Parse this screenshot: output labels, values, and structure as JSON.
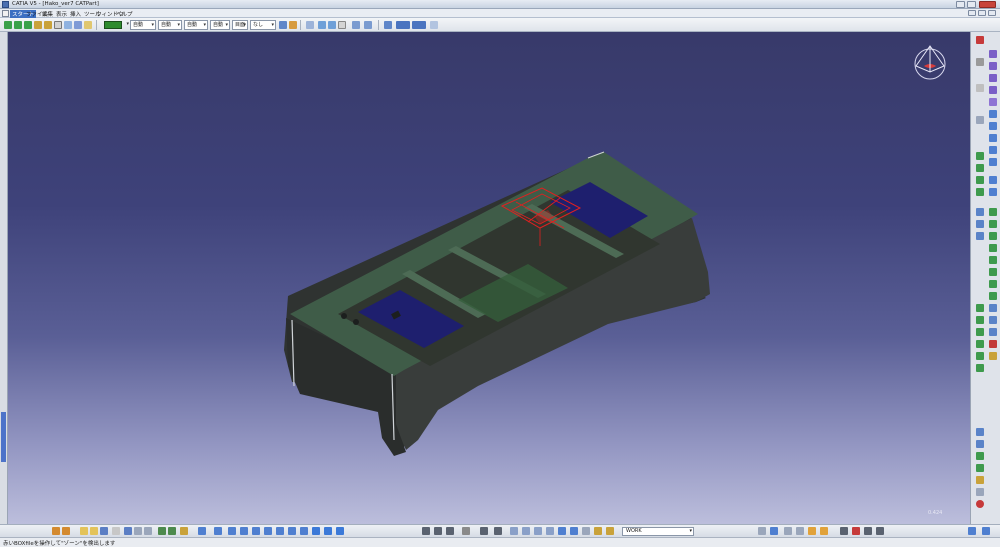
{
  "window": {
    "title": "CATIA V5 - [Hako_ver7 CATPart]"
  },
  "menu": {
    "items": [
      "スタート",
      "ファイル",
      "編集",
      "表示",
      "挿入",
      "ツール",
      "ウィンドウ",
      "ヘルプ"
    ]
  },
  "toolbar": {
    "line_type": "自動",
    "line_thickness": "自動",
    "point_type": "自動",
    "layer": "自動",
    "render_style": "目面",
    "filter": "なし",
    "fill_color": "#2e8b2e"
  },
  "workbench": {
    "work_plane": "WORK"
  },
  "viewport": {
    "zoom": "0.424",
    "compass_label": "コンパス",
    "background_top": "#383a6a",
    "background_bottom": "#bcbedc",
    "part_color": "#2f3331",
    "frame_color": "#3f5c48",
    "pocket_color": "#1e1f6e",
    "sketch_color": "#e02020"
  },
  "status": {
    "message": "赤いBOXfileを操作して\"ゾーン\"を検出します"
  },
  "icons": {
    "right_toolbar": [
      "sketch-icon",
      "pad-icon",
      "pocket-icon",
      "shaft-icon",
      "groove-icon",
      "hole-icon",
      "rib-icon",
      "slot-icon",
      "fillet-icon",
      "chamfer-icon",
      "draft-icon",
      "shell-icon",
      "thickness-icon",
      "split-icon",
      "thick-surface-icon",
      "close-surface-icon",
      "translate-icon",
      "rotate-icon",
      "symmetry-icon",
      "mirror-icon",
      "pattern-icon",
      "scale-icon",
      "boolean-add-icon",
      "boolean-remove-icon",
      "measure-icon",
      "axis-system-icon",
      "catalog-icon"
    ]
  }
}
